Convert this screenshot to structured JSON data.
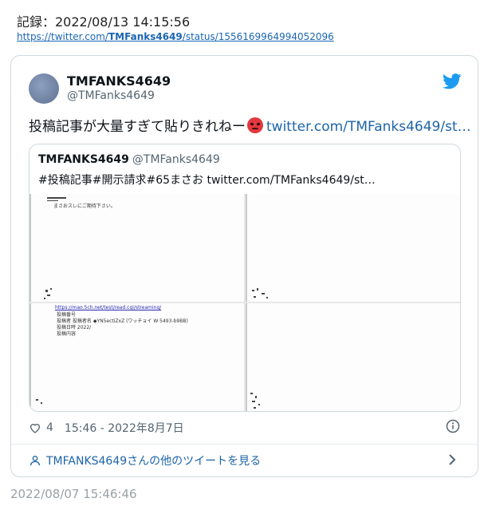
{
  "record": {
    "label": "記録：2022/08/13 14:15:56",
    "url_prefix": "https://twitter.com/",
    "url_bold": "TMFanks4649",
    "url_suffix": "/status/1556169964994052096"
  },
  "tweet": {
    "display_name": "TMFANKS4649",
    "handle": "@TMFanks4649",
    "text": "投稿記事が大量すぎて貼りきれねー",
    "emoji": "angry-face-icon",
    "link_text": "twitter.com/TMFanks4649/st…",
    "like_count": "4",
    "timestamp": "15:46 - 2022年8月7日",
    "more_tweets_label": "TMFANKS4649さんの他のツイートを見る"
  },
  "quote": {
    "display_name": "TMFANKS4649",
    "handle": "@TMFanks4649",
    "text": "#投稿記事#開示請求#65まさお twitter.com/TMFanks4649/st…",
    "scan_line_1": "まさおスレにご期待下さい。",
    "scan_line_2": "https://mao.5ch.net/test/read.cgi/streaming/",
    "scan_line_3": "投稿番号",
    "scan_line_4": "投稿者  投稿者名 ◆YN5ectiZxZ (ワッチョイ W 5493-b9BB)",
    "scan_line_5": "投稿日時    2022/",
    "scan_line_6": "投稿内容"
  },
  "footer": {
    "archived_time": "2022/08/07 15:46:46"
  },
  "colors": {
    "link": "#1d64a8",
    "twitter_blue": "#1d9bf0",
    "muted": "#536471"
  }
}
